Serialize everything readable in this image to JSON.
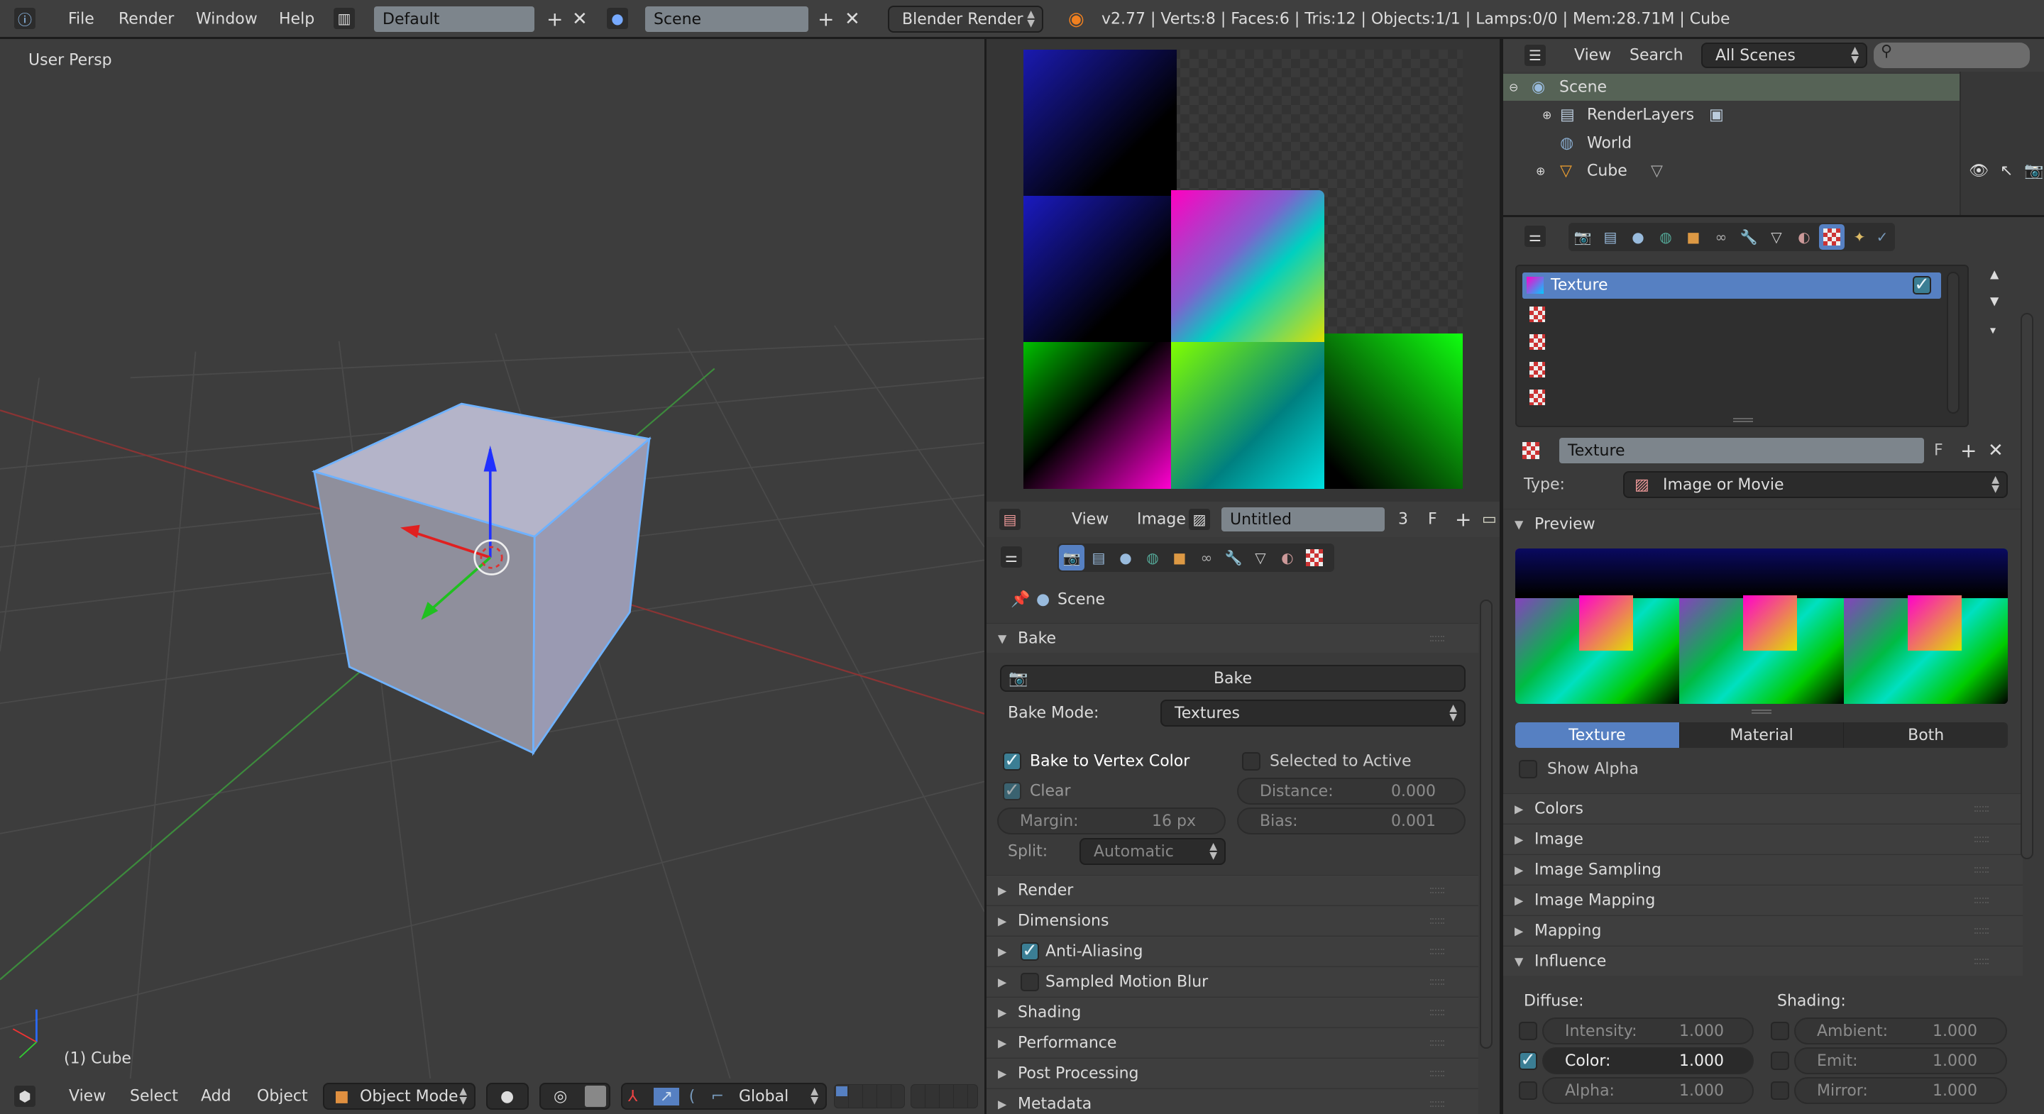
{
  "topbar": {
    "menus": [
      "File",
      "Render",
      "Window",
      "Help"
    ],
    "layout": "Default",
    "scene": "Scene",
    "engine": "Blender Render",
    "stats": "v2.77 | Verts:8 | Faces:6 | Tris:12 | Objects:1/1 | Lamps:0/0 | Mem:28.71M | Cube"
  },
  "viewport": {
    "view_label": "User Persp",
    "object_label": "(1) Cube",
    "header": {
      "menus": [
        "View",
        "Select",
        "Add",
        "Object"
      ],
      "mode": "Object Mode",
      "orientation": "Global"
    }
  },
  "image_editor": {
    "menus": [
      "View",
      "Image"
    ],
    "image_name": "Untitled",
    "users": "3",
    "fake": "F"
  },
  "render_props": {
    "context": "Scene",
    "bake": {
      "title": "Bake",
      "button": "Bake",
      "mode_label": "Bake Mode:",
      "mode": "Textures",
      "vertex_color": {
        "label": "Bake to Vertex Color",
        "checked": true
      },
      "selected_to_active": {
        "label": "Selected to Active",
        "checked": false
      },
      "clear": {
        "label": "Clear",
        "checked": true
      },
      "distance": {
        "label": "Distance:",
        "value": "0.000"
      },
      "margin": {
        "label": "Margin:",
        "value": "16 px"
      },
      "bias": {
        "label": "Bias:",
        "value": "0.001"
      },
      "split": {
        "label": "Split:",
        "value": "Automatic"
      }
    },
    "panels": [
      {
        "label": "Render"
      },
      {
        "label": "Dimensions"
      },
      {
        "label": "Anti-Aliasing",
        "checkbox": true
      },
      {
        "label": "Sampled Motion Blur",
        "checkbox": false
      },
      {
        "label": "Shading"
      },
      {
        "label": "Performance"
      },
      {
        "label": "Post Processing"
      },
      {
        "label": "Metadata"
      }
    ]
  },
  "outliner": {
    "menus": [
      "View",
      "Search"
    ],
    "filter": "All Scenes",
    "search_placeholder": "",
    "items": [
      {
        "label": "Scene"
      },
      {
        "label": "RenderLayers"
      },
      {
        "label": "World"
      },
      {
        "label": "Cube"
      }
    ]
  },
  "texture_props": {
    "slots": [
      "Texture",
      "",
      "",
      "",
      ""
    ],
    "texture_name": "Texture",
    "fake": "F",
    "type_label": "Type:",
    "type": "Image or Movie",
    "preview_title": "Preview",
    "preview_tabs": [
      "Texture",
      "Material",
      "Both"
    ],
    "active_preview_tab": "Texture",
    "show_alpha": {
      "label": "Show Alpha",
      "checked": false
    },
    "panels": [
      "Colors",
      "Image",
      "Image Sampling",
      "Image Mapping",
      "Mapping"
    ],
    "influence": {
      "title": "Influence",
      "diffuse_label": "Diffuse:",
      "shading_label": "Shading:",
      "diffuse": [
        {
          "label": "Intensity:",
          "value": "1.000",
          "checked": false
        },
        {
          "label": "Color:",
          "value": "1.000",
          "checked": true
        },
        {
          "label": "Alpha:",
          "value": "1.000",
          "checked": false
        }
      ],
      "shading": [
        {
          "label": "Ambient:",
          "value": "1.000",
          "checked": false
        },
        {
          "label": "Emit:",
          "value": "1.000",
          "checked": false
        },
        {
          "label": "Mirror:",
          "value": "1.000",
          "checked": false
        }
      ]
    }
  },
  "colors": {
    "selected_blue": "#5680c2",
    "checkbox_on": "#3b7e94",
    "selection_outline": "#6fb2ff"
  }
}
